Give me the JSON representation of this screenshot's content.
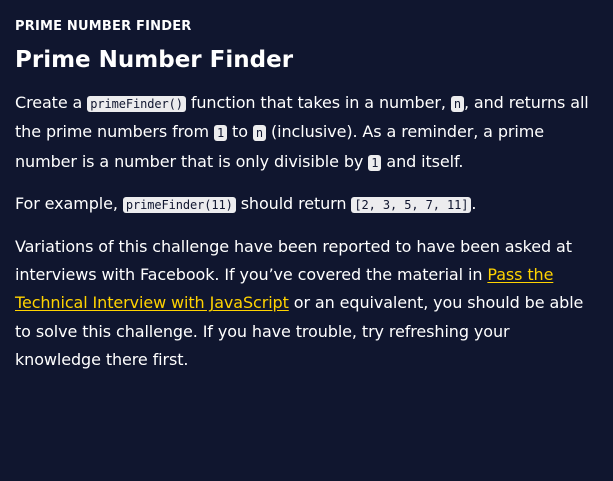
{
  "header": {
    "eyebrow": "PRIME NUMBER FINDER",
    "title": "Prime Number Finder"
  },
  "paragraph1": {
    "t1": "Create a ",
    "code1": "primeFinder()",
    "t2": " function that takes in a number, ",
    "code2": "n",
    "t3": ", and returns all the prime numbers from ",
    "code3": "1",
    "t4": " to ",
    "code4": "n",
    "t5": " (inclusive). As a reminder, a prime number is a number that is only divisible by ",
    "code5": "1",
    "t6": " and itself."
  },
  "paragraph2": {
    "t1": "For example, ",
    "code1": "primeFinder(11)",
    "t2": " should return ",
    "code2": "[2, 3, 5, 7, 11]",
    "t3": "."
  },
  "paragraph3": {
    "t1": "Variations of this challenge have been reported to have been asked at interviews with Facebook. If you’ve covered the material in ",
    "link_text": "Pass the Technical Interview with JavaScript",
    "t2": " or an equivalent, you should be able to solve this challenge. If you have trouble, try refreshing your knowledge there first."
  },
  "colors": {
    "background": "#10162f",
    "text": "#ffffff",
    "link": "#ffd300",
    "code_background": "#ececee",
    "code_text": "#10162f"
  }
}
